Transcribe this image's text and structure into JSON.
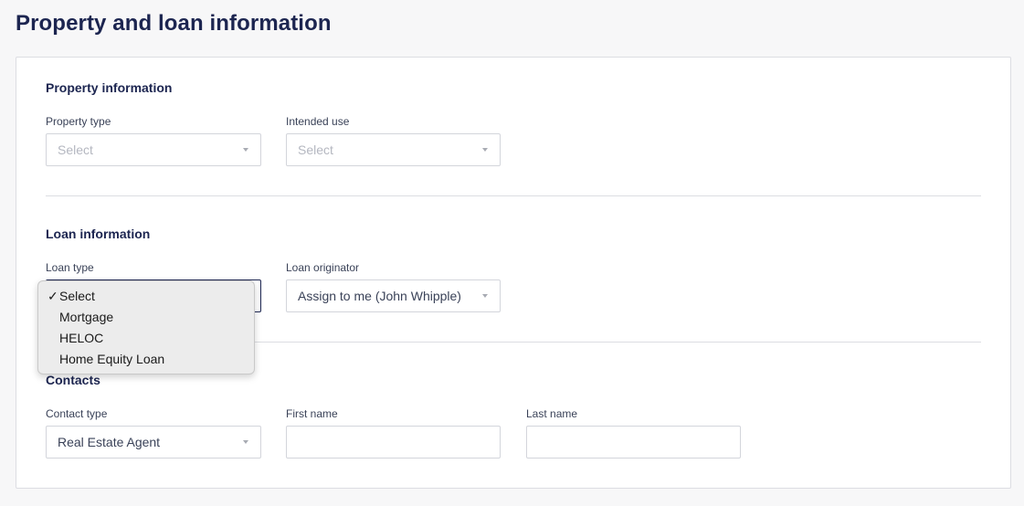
{
  "page_title": "Property and loan information",
  "property_section": {
    "title": "Property information",
    "property_type": {
      "label": "Property type",
      "value": "Select"
    },
    "intended_use": {
      "label": "Intended use",
      "value": "Select"
    }
  },
  "loan_section": {
    "title": "Loan information",
    "loan_type": {
      "label": "Loan type",
      "options": [
        "Select",
        "Mortgage",
        "HELOC",
        "Home Equity Loan"
      ],
      "selected": "Select",
      "check_mark": "✓"
    },
    "loan_originator": {
      "label": "Loan originator",
      "value": "Assign to me (John Whipple)"
    }
  },
  "contacts_section": {
    "title": "Contacts",
    "contact_type": {
      "label": "Contact type",
      "value": "Real Estate Agent"
    },
    "first_name": {
      "label": "First name",
      "value": ""
    },
    "last_name": {
      "label": "Last name",
      "value": ""
    }
  }
}
